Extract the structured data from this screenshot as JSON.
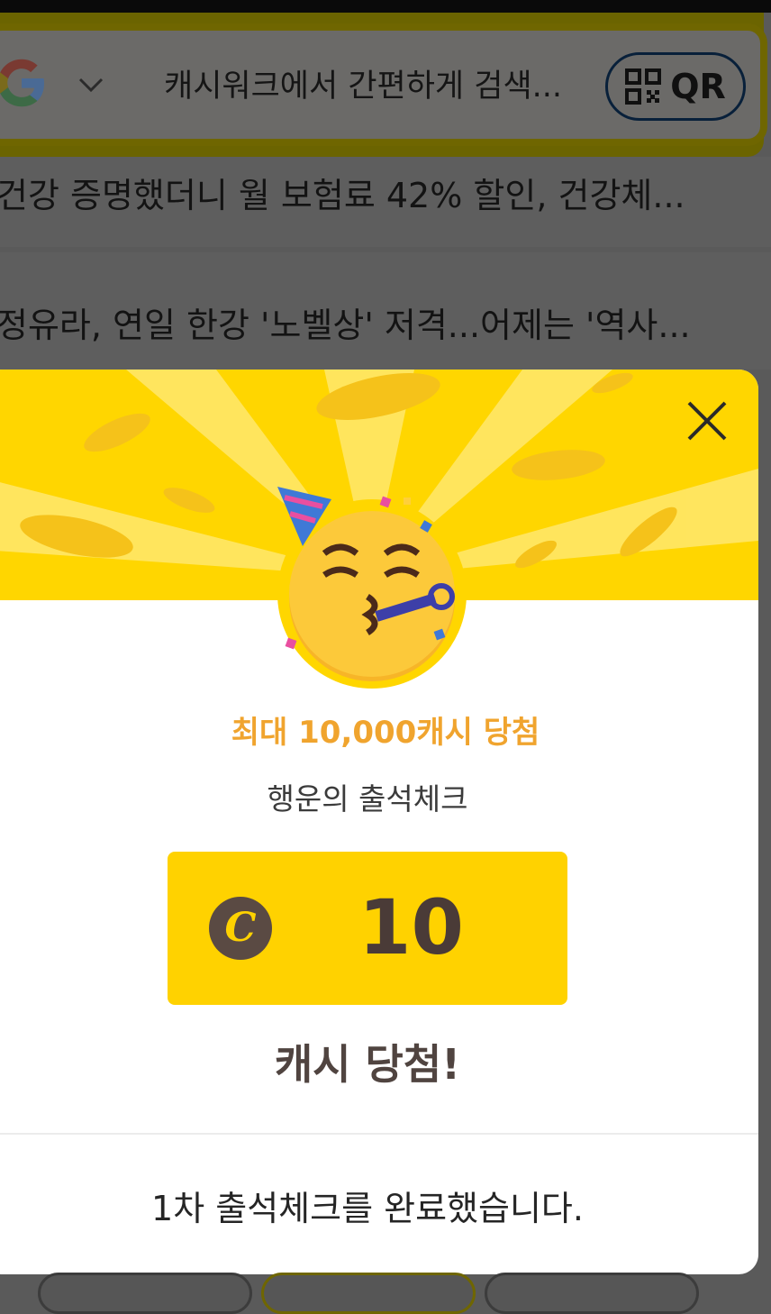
{
  "search_bar": {
    "engine_icon": "google-g-icon",
    "dropdown_icon": "chevron-down-icon",
    "text": "캐시워크에서 간편하게 검색...",
    "qr_label": "QR",
    "qr_icon": "qr-code-icon"
  },
  "news": [
    {
      "title": "건강 증명했더니 월 보험료 42% 할인, 건강체..."
    },
    {
      "title": "정유라, 연일 한강 '노벨상' 저격...어제는 '역사..."
    }
  ],
  "modal": {
    "close_icon": "close-icon",
    "emoji_icon": "partying-face-emoji",
    "headline": "최대 10,000캐시 당첨",
    "event_name": "행운의 출석체크",
    "coin_symbol": "C",
    "amount": "10",
    "result": "캐시 당첨!",
    "message": "1차 출석체크를 완료했습니다.",
    "colors": {
      "banner": "#ffd600",
      "accent": "#f0a42e",
      "cash_box": "#ffd200",
      "coin": "#5a4a43"
    }
  }
}
